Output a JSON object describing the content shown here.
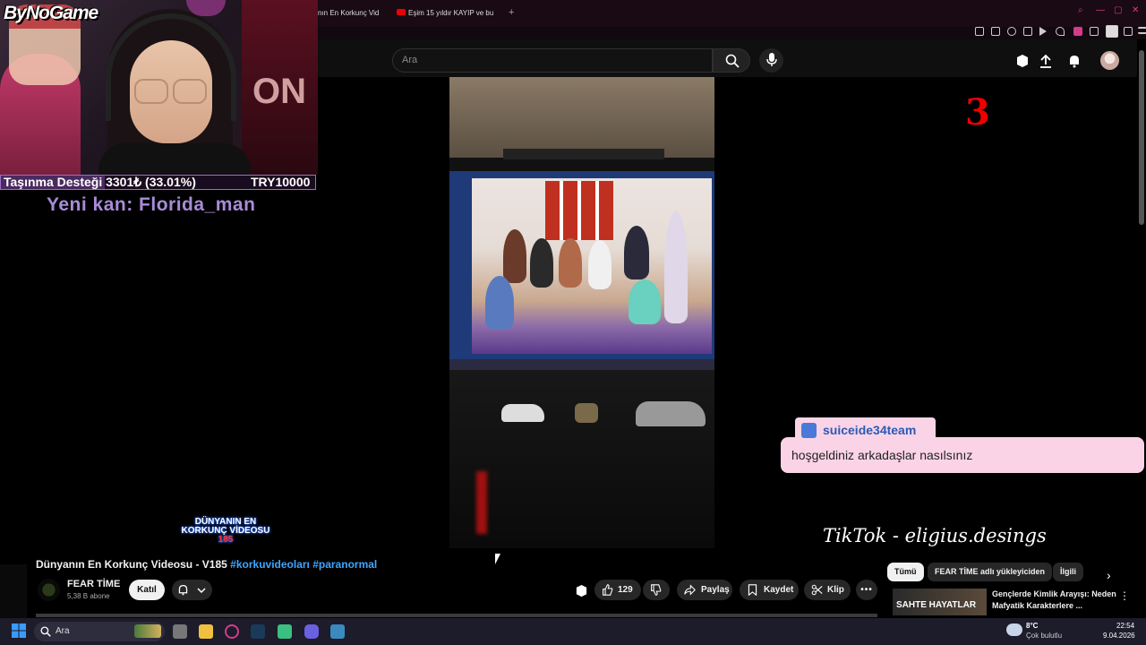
{
  "browser": {
    "tabs": [
      {
        "label": "nın En Korkunç Vid"
      },
      {
        "label": "Eşim 15 yıldır KAYIP ve bu"
      }
    ],
    "new_tab": "+"
  },
  "youtube": {
    "search_placeholder": "Ara",
    "video": {
      "title_main": "Dünyanın En Korkunç Videosu - V185",
      "hashtags": "#korkuvideoları #paranormal",
      "channel_name": "FEAR TİME",
      "subscribers": "5,38 B abone",
      "join_label": "Katıl",
      "like_count": "129",
      "share_label": "Paylaş",
      "save_label": "Kaydet",
      "clip_label": "Klip"
    },
    "chips": [
      {
        "label": "Tümü",
        "active": true
      },
      {
        "label": "FEAR TİME adlı yükleyiciden",
        "active": false
      },
      {
        "label": "İlgili",
        "active": false
      }
    ],
    "recommendation": {
      "thumb_text": "SAHTE HAYATLAR",
      "title": "Gençlerde Kimlik Arayışı: Neden Mafyatik Karakterlere ..."
    }
  },
  "overlay": {
    "logo": "ByNoGame",
    "cam_sign": "ON",
    "donation_label": "Taşınma Desteği 3301₺ (33.01%)",
    "donation_goal": "TRY10000",
    "donation_progress": 0.3301,
    "new_subscriber": "Yeni kan: Florida_man",
    "countdown": "3",
    "chat_user": "suiceide34team",
    "chat_message": "hoşgeldiniz arkadaşlar nasılsınız",
    "video_watermark_line1": "DÜNYANIN EN",
    "video_watermark_line2": "KORKUNÇ VİDEOSU",
    "video_watermark_num": "185",
    "tiktok_credit": "TikTok - eligius.desings"
  },
  "taskbar": {
    "search_label": "Ara",
    "weather_temp": "8°C",
    "weather_desc": "Çok bulutlu",
    "time": "22:54",
    "date": "9.04.2026"
  },
  "colors": {
    "yt_bg": "#0f0f0f",
    "link_blue": "#3ea6ff",
    "chat_pink": "#fad4e6",
    "accent_pink": "#d43c8a",
    "alert_red": "#e00000"
  }
}
